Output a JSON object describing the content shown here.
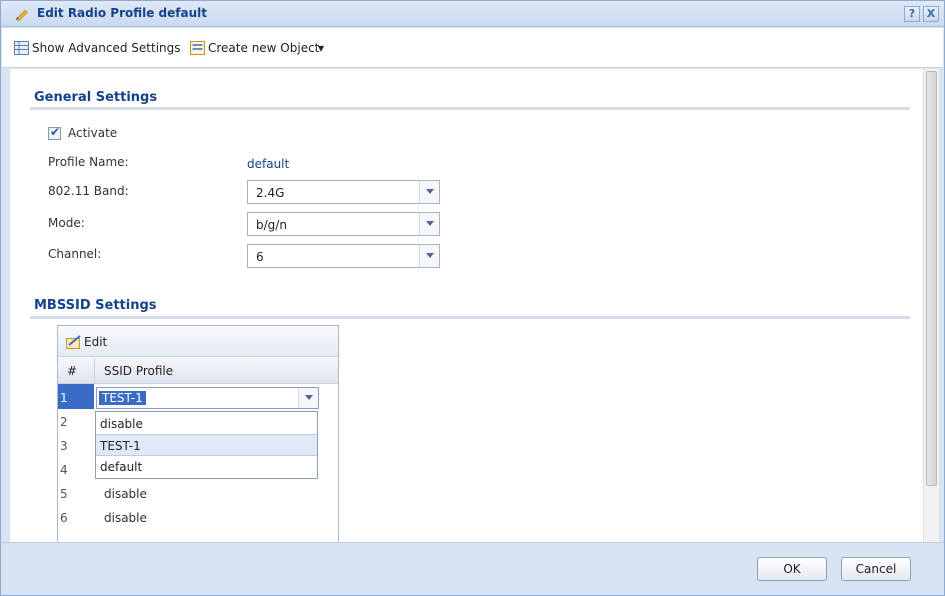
{
  "window": {
    "title": "Edit Radio Profile default",
    "help_label": "?",
    "close_label": "X",
    "edit_icon": "pencil-icon"
  },
  "toolbar": {
    "show_advanced_label": "Show Advanced Settings",
    "create_object_label": "Create new Object",
    "create_object_arrow": "▾"
  },
  "general": {
    "title": "General Settings",
    "activate_label": "Activate",
    "activate_checked": true,
    "profile_name_label": "Profile Name:",
    "profile_name_value": "default",
    "band_label": "802.11 Band:",
    "band_value": "2.4G",
    "mode_label": "Mode:",
    "mode_value": "b/g/n",
    "channel_label": "Channel:",
    "channel_value": "6"
  },
  "mbssid": {
    "title": "MBSSID Settings",
    "edit_label": "Edit",
    "col_num": "#",
    "col_ssid": "SSID Profile",
    "rows": [
      {
        "num": "1",
        "ssid": "TEST-1"
      },
      {
        "num": "2",
        "ssid": ""
      },
      {
        "num": "3",
        "ssid": ""
      },
      {
        "num": "4",
        "ssid": ""
      },
      {
        "num": "5",
        "ssid": "disable"
      },
      {
        "num": "6",
        "ssid": "disable"
      }
    ],
    "editor_value": "TEST-1",
    "dropdown_options": [
      "disable",
      "TEST-1",
      "default"
    ]
  },
  "footer": {
    "ok_label": "OK",
    "cancel_label": "Cancel"
  },
  "colors": {
    "accent": "#15428b",
    "selection": "#3a6cc7",
    "frame": "#d7e4f3"
  }
}
